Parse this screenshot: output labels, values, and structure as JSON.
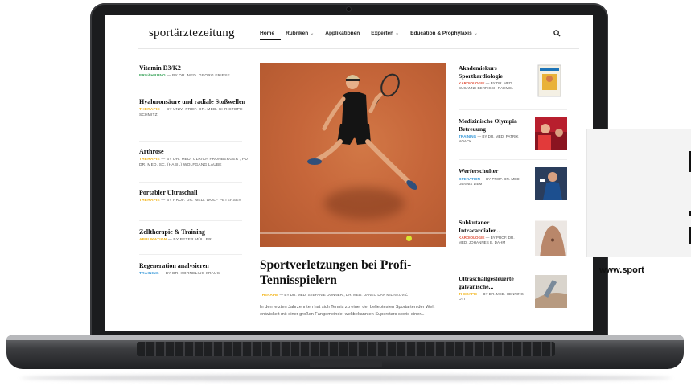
{
  "site": {
    "logo": "sportärztezeitung",
    "nav": [
      "Home",
      "Rubriken",
      "Applikationen",
      "Experten",
      "Education & Prophylaxis"
    ],
    "accent": "#f2b418",
    "blue": "#3a9ad9",
    "red": "#e0513b"
  },
  "left_articles": [
    {
      "title": "Vitamin D3/K2",
      "category": "ERNÄHRUNG",
      "byline": "— By DR. MED. GEORG FRIESE"
    },
    {
      "title": "Hyaluronsäure und radiale Stoßwellen",
      "category": "THERAPIE",
      "byline": "— By UNIV.-PROF. DR. MED. CHRISTOPH SCHMITZ"
    },
    {
      "title": "Arthrose",
      "category": "THERAPIE",
      "byline": "— By DR. MED. ULRICH FROHBERGER , PD DR. MED. SC. (HABIL) WOLFGANG LAUBE"
    },
    {
      "title": "Portabler Ultraschall",
      "category": "THERAPIE",
      "byline": "— By PROF. DR. MED. WOLF PETERSEN"
    },
    {
      "title": "Zelltherapie & Training",
      "category": "APPLIKATION",
      "byline": "— By PETER MÜLLER"
    },
    {
      "title": "Regeneration analysieren",
      "category": "TRAINING",
      "byline": "— By DR. KORNELIUS KRAUS"
    }
  ],
  "hero": {
    "title": "Sportverletzungen bei Profi-Tennisspielern",
    "category": "THERAPIE",
    "byline": "— By DR. MED. STEFANIE DONNER , DR. MED. DANKO DAN MILINKOVIĆ",
    "excerpt": "In den letzten Jahrzehnten hat sich Tennis zu einer der beliebtesten Sportarten der Welt entwickelt mit einer großen Fangemeinde, weltbekannten Superstars sowie einer..."
  },
  "right_articles": [
    {
      "title": "Akademiekurs Sportkardiologie",
      "category": "KARDIOLOGIE",
      "byline": "— By DR. MED. SUSANNE BERRISCH-RAHMEL"
    },
    {
      "title": "Medizinische Olympia Betreuung",
      "category": "TRAINING",
      "byline": "— By DR. MED. PATRIK NOACK"
    },
    {
      "title": "Werferschulter",
      "category": "OPERATION",
      "byline": "— By PROF. DR. MED. DENNIS LIEM"
    },
    {
      "title": "Subkutaner Intracardialer...",
      "category": "KARDIOLOGIE",
      "byline": "— By PROF. DR. MED. JOHANNES B. DAHM"
    },
    {
      "title": "Ultraschallgesteuerte galvanische...",
      "category": "THERAPIE",
      "byline": "— By DR. MED. HENNING OTT"
    }
  ],
  "overlay": {
    "url": "www.sport"
  }
}
